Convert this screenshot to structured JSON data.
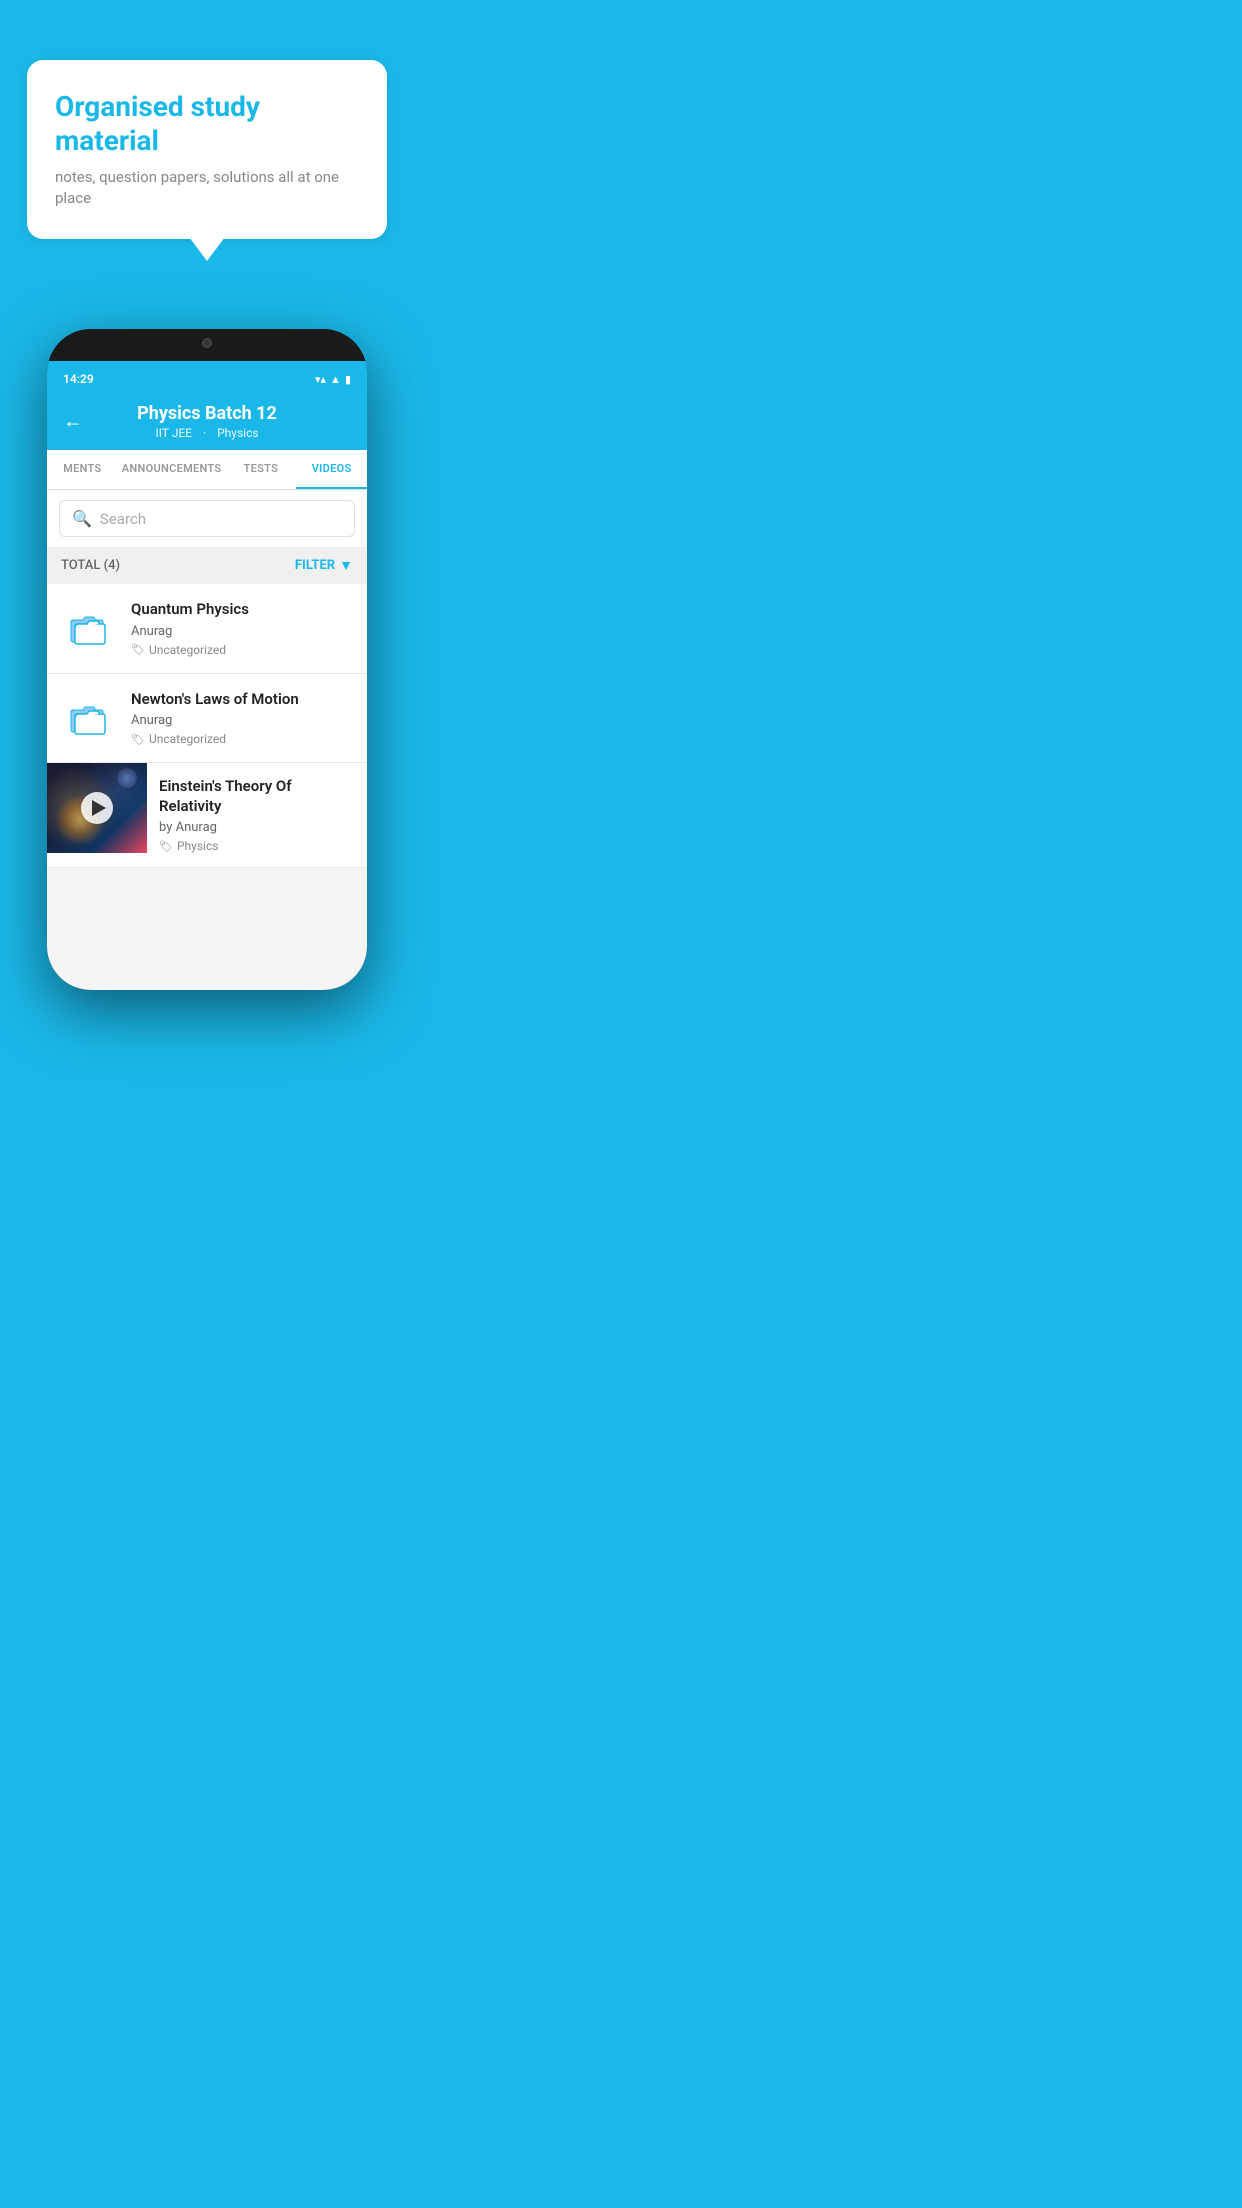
{
  "page": {
    "background_color": "#1ab8e8"
  },
  "speech_bubble": {
    "title": "Organised study material",
    "subtitle": "notes, question papers, solutions all at one place"
  },
  "status_bar": {
    "time": "14:29",
    "icons": [
      "wifi",
      "signal",
      "battery"
    ]
  },
  "header": {
    "title": "Physics Batch 12",
    "subtitle_part1": "IIT JEE",
    "subtitle_part2": "Physics",
    "back_label": "←"
  },
  "tabs": [
    {
      "label": "MENTS",
      "active": false
    },
    {
      "label": "ANNOUNCEMENTS",
      "active": false
    },
    {
      "label": "TESTS",
      "active": false
    },
    {
      "label": "VIDEOS",
      "active": true
    }
  ],
  "search": {
    "placeholder": "Search"
  },
  "filter": {
    "total_label": "TOTAL (4)",
    "button_label": "FILTER"
  },
  "videos": [
    {
      "title": "Quantum Physics",
      "author": "Anurag",
      "tag": "Uncategorized",
      "type": "folder",
      "has_thumbnail": false
    },
    {
      "title": "Newton's Laws of Motion",
      "author": "Anurag",
      "tag": "Uncategorized",
      "type": "folder",
      "has_thumbnail": false
    },
    {
      "title": "Einstein's Theory Of Relativity",
      "author": "by Anurag",
      "tag": "Physics",
      "type": "video",
      "has_thumbnail": true
    }
  ]
}
